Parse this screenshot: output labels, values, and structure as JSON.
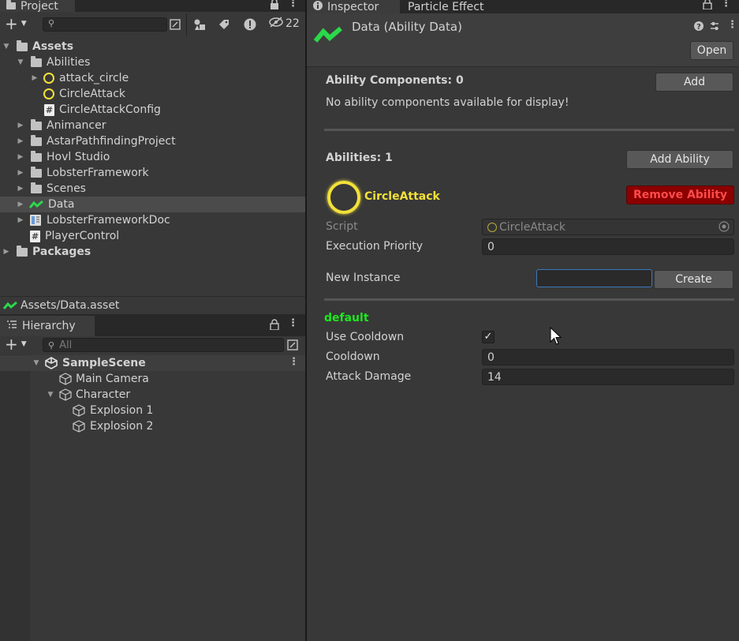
{
  "project": {
    "tab_label": "Project",
    "hidden_count": "22",
    "tree": [
      {
        "label": "Assets",
        "icon": "folder-open-icon",
        "bold": true
      },
      {
        "label": "Abilities",
        "icon": "folder-open-icon"
      },
      {
        "label": "attack_circle",
        "icon": "circle-ability-icon"
      },
      {
        "label": "CircleAttack",
        "icon": "circle-ability-icon"
      },
      {
        "label": "CircleAttackConfig",
        "icon": "script-icon"
      },
      {
        "label": "Animancer",
        "icon": "folder-icon"
      },
      {
        "label": "AstarPathfindingProject",
        "icon": "folder-icon"
      },
      {
        "label": "Hovl Studio",
        "icon": "folder-icon"
      },
      {
        "label": "LobsterFramework",
        "icon": "folder-icon"
      },
      {
        "label": "Scenes",
        "icon": "folder-icon"
      },
      {
        "label": "Data",
        "icon": "data-asset-icon"
      },
      {
        "label": "LobsterFrameworkDoc",
        "icon": "book-icon"
      },
      {
        "label": "PlayerControl",
        "icon": "script-icon"
      },
      {
        "label": "Packages",
        "icon": "folder-icon",
        "bold": true
      }
    ],
    "path": "Assets/Data.asset"
  },
  "hierarchy": {
    "tab_label": "Hierarchy",
    "search_placeholder": "All",
    "items": [
      {
        "label": "SampleScene",
        "icon": "unity-scene-icon"
      },
      {
        "label": "Main Camera",
        "icon": "cube-icon"
      },
      {
        "label": "Character",
        "icon": "cube-icon"
      },
      {
        "label": "Explosion 1",
        "icon": "cube-icon"
      },
      {
        "label": "Explosion 2",
        "icon": "cube-icon"
      }
    ]
  },
  "inspector": {
    "tabs": [
      "Inspector",
      "Particle Effect"
    ],
    "asset_title": "Data (Ability Data)",
    "open_label": "Open",
    "ability_components_label": "Ability Components: 0",
    "add_label": "Add",
    "no_components_msg": "No ability components available for display!",
    "abilities_label": "Abilities: 1",
    "add_ability_label": "Add Ability",
    "ability_name": "CircleAttack",
    "remove_ability_label": "Remove Ability",
    "script_label": "Script",
    "script_value": "CircleAttack",
    "execution_priority_label": "Execution Priority",
    "execution_priority_value": "0",
    "new_instance_label": "New Instance",
    "new_instance_value": "",
    "create_label": "Create",
    "config_name": "default",
    "use_cooldown_label": "Use Cooldown",
    "use_cooldown_checked": true,
    "cooldown_label": "Cooldown",
    "cooldown_value": "0",
    "attack_damage_label": "Attack Damage",
    "attack_damage_value": "14"
  },
  "colors": {
    "accent_yellow": "#f2e13a",
    "remove_red": "#8b0000",
    "remove_text": "#ff4a4a",
    "default_green": "#1ee61e",
    "data_icon_green": "#2bd94a"
  }
}
